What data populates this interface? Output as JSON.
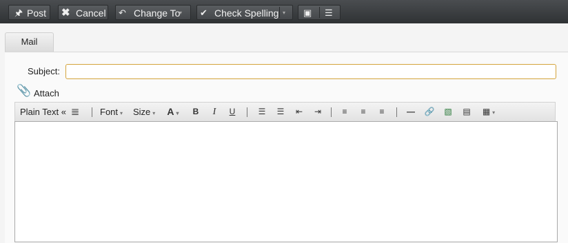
{
  "toolbar": {
    "post_label": "Post",
    "cancel_label": "Cancel",
    "change_to_label": "Change To",
    "check_spelling_label": "Check Spelling"
  },
  "tabs": [
    {
      "label": "Mail"
    }
  ],
  "form": {
    "subject_label": "Subject:",
    "subject_value": "",
    "attach_label": "Attach"
  },
  "editor_toolbar": {
    "plain_text_label": "Plain Text «",
    "font_label": "Font",
    "size_label": "Size"
  },
  "colors": {
    "toolbar_bg": "#3a3d40",
    "subject_focus_border": "#d4a33a"
  }
}
